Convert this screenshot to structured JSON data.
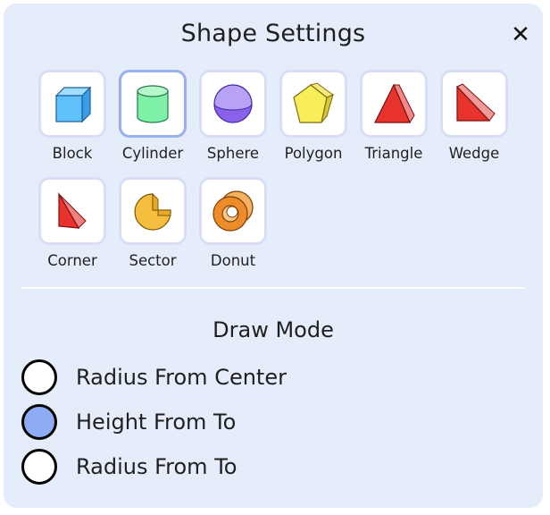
{
  "dialog": {
    "title": "Shape Settings",
    "close_label": "✕"
  },
  "shapes": [
    {
      "label": "Block",
      "icon": "block-icon",
      "selected": false
    },
    {
      "label": "Cylinder",
      "icon": "cylinder-icon",
      "selected": true
    },
    {
      "label": "Sphere",
      "icon": "sphere-icon",
      "selected": false
    },
    {
      "label": "Polygon",
      "icon": "polygon-icon",
      "selected": false
    },
    {
      "label": "Triangle",
      "icon": "triangle-icon",
      "selected": false
    },
    {
      "label": "Wedge",
      "icon": "wedge-icon",
      "selected": false
    },
    {
      "label": "Corner",
      "icon": "corner-icon",
      "selected": false
    },
    {
      "label": "Sector",
      "icon": "sector-icon",
      "selected": false
    },
    {
      "label": "Donut",
      "icon": "donut-icon",
      "selected": false
    }
  ],
  "draw_mode": {
    "title": "Draw Mode",
    "options": [
      {
        "label": "Radius From Center",
        "checked": false
      },
      {
        "label": "Height From To",
        "checked": true
      },
      {
        "label": "Radius From To",
        "checked": false
      }
    ]
  },
  "colors": {
    "panel_bg": "#e6edfa",
    "tile_border": "#d7def6",
    "tile_selected_border": "#98b0ee",
    "radio_checked": "#8eacf3"
  }
}
